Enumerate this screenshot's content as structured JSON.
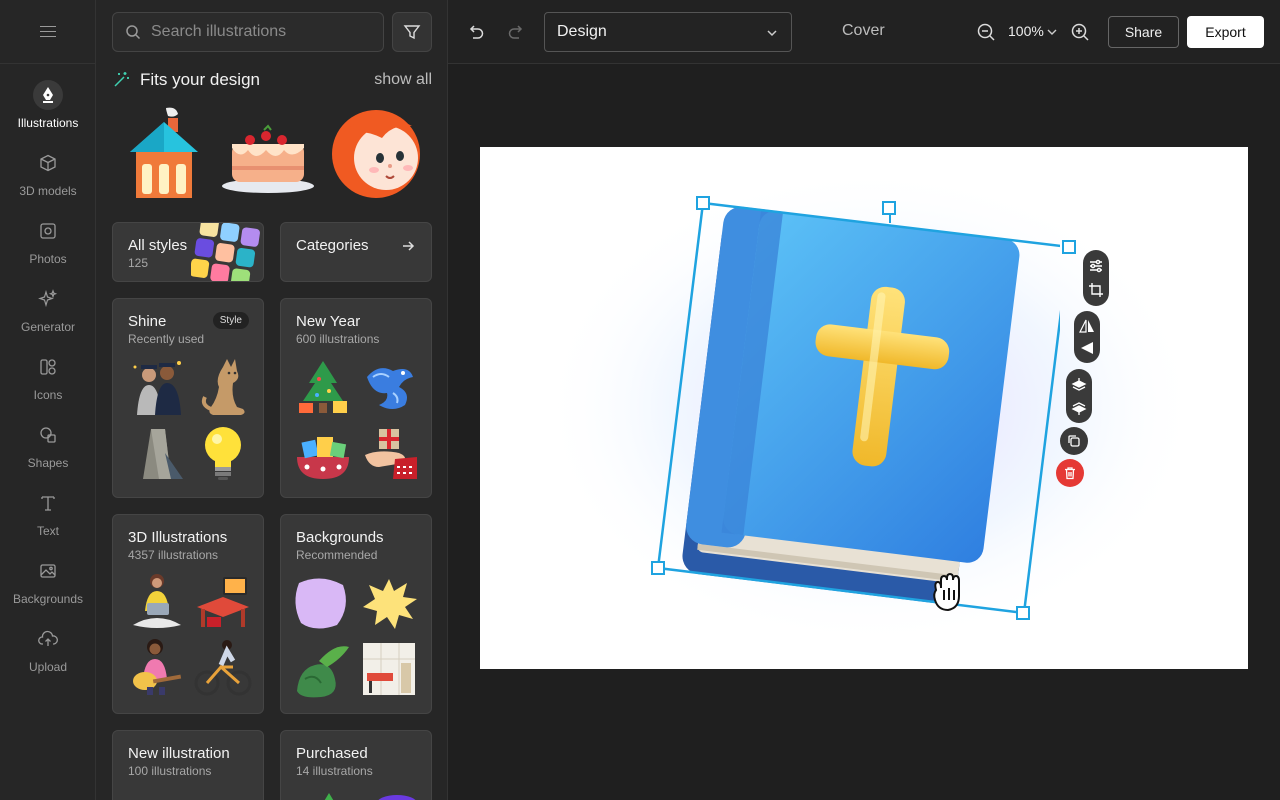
{
  "rail": {
    "items": [
      {
        "label": "Illustrations",
        "icon": "pen-nib-icon",
        "active": true
      },
      {
        "label": "3D models",
        "icon": "cube-icon"
      },
      {
        "label": "Photos",
        "icon": "photo-icon"
      },
      {
        "label": "Generator",
        "icon": "sparkles-icon"
      },
      {
        "label": "Icons",
        "icon": "icons-grid-icon"
      },
      {
        "label": "Shapes",
        "icon": "shapes-icon"
      },
      {
        "label": "Text",
        "icon": "text-t-icon"
      },
      {
        "label": "Backgrounds",
        "icon": "image-icon"
      },
      {
        "label": "Upload",
        "icon": "cloud-upload-icon"
      }
    ]
  },
  "panel": {
    "search_placeholder": "Search illustrations",
    "fits_title": "Fits your design",
    "show_all": "show all",
    "all_styles": {
      "title": "All styles",
      "count": "125"
    },
    "categories": {
      "title": "Categories"
    },
    "cards": [
      {
        "title": "Shine",
        "subtitle": "Recently used",
        "badge": "Style"
      },
      {
        "title": "New Year",
        "subtitle": "600 illustrations"
      },
      {
        "title": "3D Illustrations",
        "subtitle": "4357 illustrations"
      },
      {
        "title": "Backgrounds",
        "subtitle": "Recommended"
      },
      {
        "title": "New illustration",
        "subtitle": "100 illustrations"
      },
      {
        "title": "Purchased",
        "subtitle": "14 illustrations"
      }
    ]
  },
  "topbar": {
    "design_select": "Design",
    "cover": "Cover",
    "zoom": "100%",
    "share": "Share",
    "export": "Export"
  },
  "colors": {
    "selection": "#1fa3e0",
    "delete": "#e53935",
    "book_blue": "#3f9de8",
    "cross": "#f6d04d"
  }
}
